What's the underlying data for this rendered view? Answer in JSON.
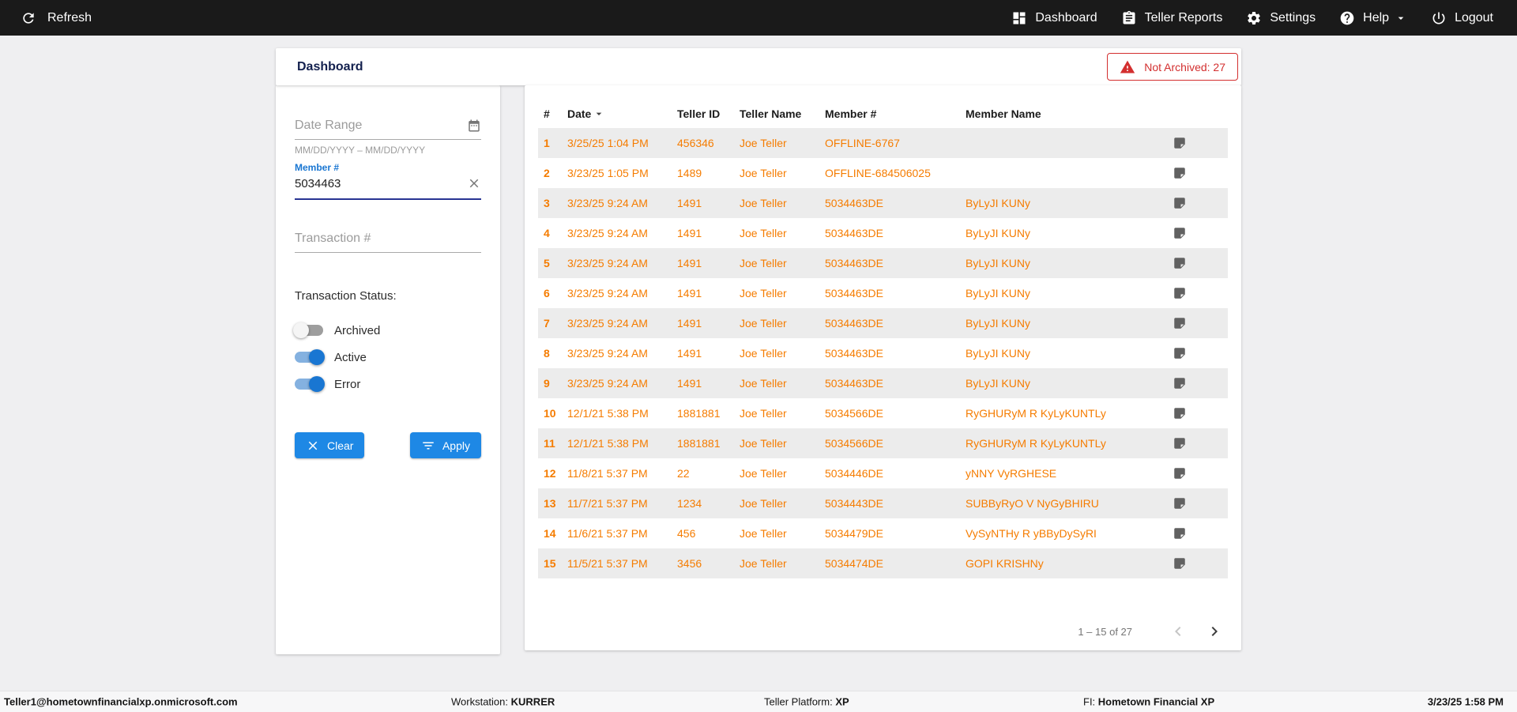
{
  "colors": {
    "topnav_bg": "#1a1a1a",
    "accent_orange": "#f57c00",
    "primary_blue": "#1e88e5",
    "toggle_blue": "#1976d2",
    "error_red": "#d32f2f",
    "stripe_gray": "#ececec"
  },
  "topnav": {
    "refresh_label": "Refresh",
    "items": [
      {
        "label": "Dashboard",
        "icon": "dashboard-icon"
      },
      {
        "label": "Teller Reports",
        "icon": "reports-icon"
      },
      {
        "label": "Settings",
        "icon": "gear-icon"
      },
      {
        "label": "Help",
        "icon": "help-icon"
      },
      {
        "label": "Logout",
        "icon": "power-icon"
      }
    ]
  },
  "header": {
    "title": "Dashboard",
    "badge_label": "Not Archived: 27"
  },
  "filters": {
    "date_range": {
      "placeholder": "Date Range",
      "helper": "MM/DD/YYYY – MM/DD/YYYY"
    },
    "member": {
      "label": "Member #",
      "value": "5034463"
    },
    "transaction": {
      "placeholder": "Transaction #"
    },
    "status_label": "Transaction Status:",
    "toggles": [
      {
        "label": "Archived",
        "on": false
      },
      {
        "label": "Active",
        "on": true
      },
      {
        "label": "Error",
        "on": true
      }
    ],
    "clear_label": "Clear",
    "apply_label": "Apply"
  },
  "table": {
    "columns": {
      "num": "#",
      "date": "Date",
      "teller_id": "Teller ID",
      "teller_name": "Teller Name",
      "member_num": "Member #",
      "member_name": "Member Name"
    },
    "rows": [
      {
        "num": "1",
        "date": "3/25/25 1:04 PM",
        "teller_id": "456346",
        "teller_name": "Joe Teller",
        "member_num": "OFFLINE-6767",
        "member_name": ""
      },
      {
        "num": "2",
        "date": "3/23/25 1:05 PM",
        "teller_id": "1489",
        "teller_name": "Joe Teller",
        "member_num": "OFFLINE-684506025",
        "member_name": ""
      },
      {
        "num": "3",
        "date": "3/23/25 9:24 AM",
        "teller_id": "1491",
        "teller_name": "Joe Teller",
        "member_num": "5034463DE",
        "member_name": "ByLyJI KUNy"
      },
      {
        "num": "4",
        "date": "3/23/25 9:24 AM",
        "teller_id": "1491",
        "teller_name": "Joe Teller",
        "member_num": "5034463DE",
        "member_name": "ByLyJI KUNy"
      },
      {
        "num": "5",
        "date": "3/23/25 9:24 AM",
        "teller_id": "1491",
        "teller_name": "Joe Teller",
        "member_num": "5034463DE",
        "member_name": "ByLyJI KUNy"
      },
      {
        "num": "6",
        "date": "3/23/25 9:24 AM",
        "teller_id": "1491",
        "teller_name": "Joe Teller",
        "member_num": "5034463DE",
        "member_name": "ByLyJI KUNy"
      },
      {
        "num": "7",
        "date": "3/23/25 9:24 AM",
        "teller_id": "1491",
        "teller_name": "Joe Teller",
        "member_num": "5034463DE",
        "member_name": "ByLyJI KUNy"
      },
      {
        "num": "8",
        "date": "3/23/25 9:24 AM",
        "teller_id": "1491",
        "teller_name": "Joe Teller",
        "member_num": "5034463DE",
        "member_name": "ByLyJI KUNy"
      },
      {
        "num": "9",
        "date": "3/23/25 9:24 AM",
        "teller_id": "1491",
        "teller_name": "Joe Teller",
        "member_num": "5034463DE",
        "member_name": "ByLyJI KUNy"
      },
      {
        "num": "10",
        "date": "12/1/21 5:38 PM",
        "teller_id": "1881881",
        "teller_name": "Joe Teller",
        "member_num": "5034566DE",
        "member_name": "RyGHURyM R KyLyKUNTLy"
      },
      {
        "num": "11",
        "date": "12/1/21 5:38 PM",
        "teller_id": "1881881",
        "teller_name": "Joe Teller",
        "member_num": "5034566DE",
        "member_name": "RyGHURyM R KyLyKUNTLy"
      },
      {
        "num": "12",
        "date": "11/8/21 5:37 PM",
        "teller_id": "22",
        "teller_name": "Joe Teller",
        "member_num": "5034446DE",
        "member_name": "yNNY VyRGHESE"
      },
      {
        "num": "13",
        "date": "11/7/21 5:37 PM",
        "teller_id": "1234",
        "teller_name": "Joe Teller",
        "member_num": "5034443DE",
        "member_name": "SUBByRyO V NyGyBHIRU"
      },
      {
        "num": "14",
        "date": "11/6/21 5:37 PM",
        "teller_id": "456",
        "teller_name": "Joe Teller",
        "member_num": "5034479DE",
        "member_name": "VySyNTHy R yBByDySyRI"
      },
      {
        "num": "15",
        "date": "11/5/21 5:37 PM",
        "teller_id": "3456",
        "teller_name": "Joe Teller",
        "member_num": "5034474DE",
        "member_name": "GOPI KRISHNy"
      }
    ],
    "pagination": {
      "range_label": "1 – 15 of 27"
    }
  },
  "statusbar": {
    "user": "Teller1@hometownfinancialxp.onmicrosoft.com",
    "workstation_label": "Workstation:",
    "workstation_value": "KURRER",
    "platform_label": "Teller Platform:",
    "platform_value": "XP",
    "fi_label": "FI:",
    "fi_value": "Hometown Financial XP",
    "datetime": "3/23/25 1:58 PM"
  }
}
